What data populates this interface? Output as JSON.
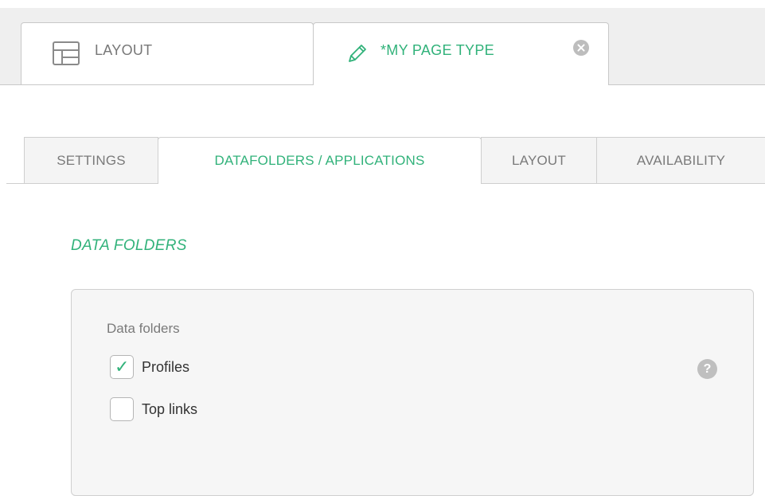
{
  "document_tabs": [
    {
      "label": "LAYOUT",
      "icon": "layout-icon",
      "active": false
    },
    {
      "label": "*MY PAGE TYPE",
      "icon": "pencil-icon",
      "active": true,
      "closable": true
    }
  ],
  "settings_tabs": [
    {
      "label": "SETTINGS",
      "active": false
    },
    {
      "label": "DATAFOLDERS / APPLICATIONS",
      "active": true
    },
    {
      "label": "LAYOUT",
      "active": false
    },
    {
      "label": "AVAILABILITY",
      "active": false
    }
  ],
  "section": {
    "title": "DATA FOLDERS",
    "group_label": "Data folders",
    "options": [
      {
        "label": "Profiles",
        "checked": true
      },
      {
        "label": "Top links",
        "checked": false
      }
    ],
    "help_glyph": "?"
  },
  "colors": {
    "accent": "#31b27a",
    "muted_text": "#7a7a7a",
    "border": "#cfcfcf"
  }
}
